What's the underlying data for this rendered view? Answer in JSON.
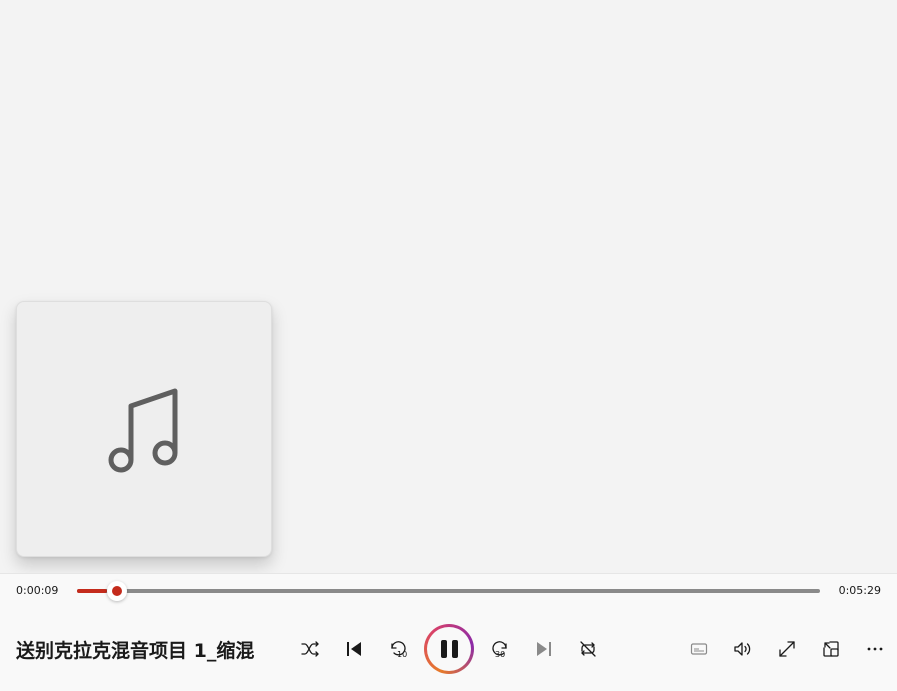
{
  "player": {
    "current_time": "0:00:09",
    "duration": "0:05:29",
    "progress_fraction": 0.041,
    "track_title": "送别克拉克混音项目 1_缩混",
    "accent_color": "#c42b1c"
  },
  "album_art": {
    "icon": "music-note-icon"
  },
  "controls": {
    "shuffle_icon": "shuffle-icon",
    "previous_icon": "previous-icon",
    "skip_back_icon": "skip-back-10-icon",
    "skip_back_label": "10",
    "play_pause_icon": "pause-icon",
    "skip_forward_icon": "skip-forward-30-icon",
    "skip_forward_label": "30",
    "next_icon": "next-icon",
    "repeat_icon": "repeat-off-icon",
    "captions_icon": "captions-icon",
    "volume_icon": "volume-icon",
    "fullscreen_icon": "fullscreen-icon",
    "miniplayer_icon": "miniplayer-icon",
    "more_icon": "more-icon"
  }
}
